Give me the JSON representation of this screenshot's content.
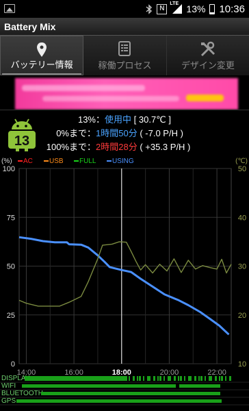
{
  "status_bar": {
    "left_icon": "image-icon",
    "icons": [
      "bluetooth-icon",
      "nfc-icon",
      "lte-signal-icon"
    ],
    "battery_pct": "13%",
    "time": "10:36"
  },
  "app": {
    "title": "Battery Mix"
  },
  "tabs": [
    {
      "label": "バッテリー情報",
      "icon": "location-pin-icon",
      "active": true
    },
    {
      "label": "稼働プロセス",
      "icon": "list-icon",
      "active": false
    },
    {
      "label": "デザイン変更",
      "icon": "tools-icon",
      "active": false
    }
  ],
  "ad": {
    "description": "blurred pink advertisement banner"
  },
  "battery": {
    "badge_level": "13",
    "status_percent": "13%",
    "status_text": "使用中",
    "temperature": "[ 30.7℃ ]",
    "row0_label": "0%まで：",
    "row0_time": "1時間50分",
    "row0_rate": "( -7.0 P/H )",
    "row100_label": "100%まで：",
    "row100_time": "2時間28分",
    "row100_rate": "( +35.3 P/H )"
  },
  "chart_data": {
    "type": "line",
    "legend": [
      {
        "name": "AC",
        "color": "#ff2020"
      },
      {
        "name": "USB",
        "color": "#ff8c1a"
      },
      {
        "name": "FULL",
        "color": "#19d419"
      },
      {
        "name": "USING",
        "color": "#4a90ff"
      }
    ],
    "left_unit": "(%)",
    "right_unit": "(℃)",
    "y_ticks_left": [
      "100",
      "75",
      "50",
      "25",
      "0"
    ],
    "y_ticks_right": [
      "50",
      "40",
      "30",
      "20",
      "10"
    ],
    "ylim_left": [
      0,
      100
    ],
    "ylim_right": [
      10,
      50
    ],
    "x_ticks": [
      "14:00",
      "16:00",
      "18:00",
      "20:00",
      "22:00"
    ],
    "xlim": [
      13.7,
      22.6
    ],
    "grid": true,
    "current_marker_x": 18.0,
    "series": [
      {
        "name": "USING",
        "color": "#4a90ff",
        "axis": "left",
        "points": [
          [
            13.7,
            64.8
          ],
          [
            14.2,
            64.0
          ],
          [
            14.7,
            62.8
          ],
          [
            15.2,
            62.2
          ],
          [
            15.7,
            62.2
          ],
          [
            15.8,
            61.2
          ],
          [
            16.3,
            61.0
          ],
          [
            16.6,
            59.5
          ],
          [
            17.0,
            55.5
          ],
          [
            17.3,
            52.0
          ],
          [
            17.5,
            49.5
          ],
          [
            18.0,
            48.0
          ],
          [
            18.4,
            47.0
          ],
          [
            18.8,
            43.5
          ],
          [
            19.3,
            39.5
          ],
          [
            19.8,
            35.5
          ],
          [
            20.4,
            32.5
          ],
          [
            20.8,
            30.0
          ],
          [
            21.3,
            26.5
          ],
          [
            21.7,
            23.0
          ],
          [
            22.1,
            19.5
          ],
          [
            22.5,
            15.0
          ]
        ]
      },
      {
        "name": "temperature",
        "color": "#7a8a40",
        "axis": "right",
        "points": [
          [
            13.7,
            23.0
          ],
          [
            14.0,
            22.4
          ],
          [
            14.5,
            21.8
          ],
          [
            15.0,
            21.8
          ],
          [
            15.4,
            21.8
          ],
          [
            15.8,
            22.6
          ],
          [
            16.3,
            23.8
          ],
          [
            16.6,
            26.8
          ],
          [
            17.0,
            31.5
          ],
          [
            17.2,
            34.3
          ],
          [
            17.6,
            34.5
          ],
          [
            17.9,
            35.0
          ],
          [
            18.2,
            34.9
          ],
          [
            18.4,
            33.0
          ],
          [
            18.6,
            31.0
          ],
          [
            18.8,
            29.2
          ],
          [
            19.0,
            30.3
          ],
          [
            19.3,
            28.6
          ],
          [
            19.6,
            30.4
          ],
          [
            19.9,
            29.0
          ],
          [
            20.2,
            31.5
          ],
          [
            20.5,
            28.7
          ],
          [
            20.8,
            31.2
          ],
          [
            21.1,
            29.4
          ],
          [
            21.4,
            30.1
          ],
          [
            21.7,
            29.7
          ],
          [
            22.0,
            29.4
          ],
          [
            22.2,
            31.4
          ],
          [
            22.4,
            28.6
          ],
          [
            22.6,
            30.4
          ]
        ]
      }
    ],
    "bottom_bars": [
      "DISPLAY",
      "WIFI",
      "BLUETOOTH",
      "GPS"
    ]
  }
}
